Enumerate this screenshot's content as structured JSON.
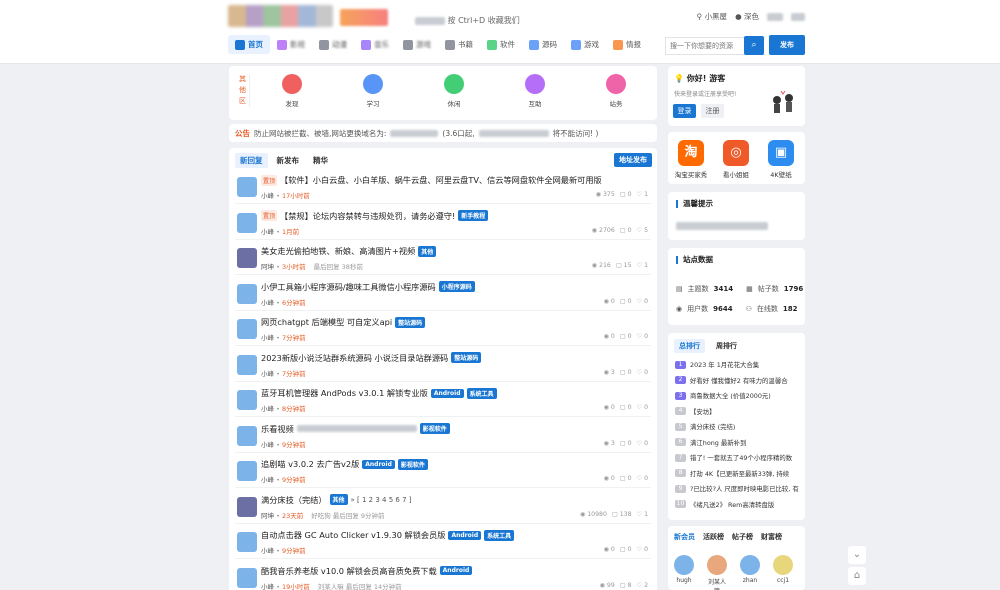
{
  "header": {
    "notice": "按 Ctrl+D 收藏我们",
    "login_label": "小黑屋",
    "register_label": "深色"
  },
  "nav": [
    {
      "label": "首页",
      "icon": "home-icon",
      "color": "#1976d2"
    },
    {
      "label": "影视",
      "icon": "video-icon",
      "color": "#a855f7"
    },
    {
      "label": "动漫",
      "icon": "anime-icon",
      "color": "#6b7280"
    },
    {
      "label": "音乐",
      "icon": "music-icon",
      "color": "#8b5cf6"
    },
    {
      "label": "游戏",
      "icon": "game-icon",
      "color": "#6b7280"
    },
    {
      "label": "书籍",
      "icon": "book-icon",
      "color": "#6b7280"
    },
    {
      "label": "软件",
      "icon": "grid-icon",
      "color": "#22c55e"
    },
    {
      "label": "源码",
      "icon": "code-icon",
      "color": "#3b82f6"
    },
    {
      "label": "游戏",
      "icon": "gamepad-icon",
      "color": "#3b82f6"
    },
    {
      "label": "情报",
      "icon": "info-icon",
      "color": "#f97316"
    }
  ],
  "search": {
    "placeholder": "搜一下你想要的资源",
    "submit_icon": "search-icon",
    "post_label": "发布"
  },
  "quick": {
    "label": "其他区",
    "items": [
      {
        "label": "发现",
        "color": "#ef4444"
      },
      {
        "label": "学习",
        "color": "#3b82f6"
      },
      {
        "label": "休闲",
        "color": "#22c55e"
      },
      {
        "label": "互助",
        "color": "#a855f7"
      },
      {
        "label": "站务",
        "color": "#ec4899"
      }
    ]
  },
  "announcement": {
    "tag": "公告",
    "text": "防止网站被拦截、被墙,网站更换域名为:",
    "text2": "(3.6口起,",
    "text3": "将不能访问! )"
  },
  "feed": {
    "tabs": [
      "新回复",
      "新发布",
      "精华"
    ],
    "address_label": "地址发布",
    "posts": [
      {
        "tag": "置顶",
        "title": "【软件】小白云盘、小白羊版、蜗牛云盘、阿里云盘TV、信云等网盘软件全网最新可用版",
        "badges": [],
        "user": "小峰",
        "time": "17小时前",
        "views": "375",
        "replies": "0",
        "likes": "1",
        "avatar": "#7cb3e8"
      },
      {
        "tag": "置顶",
        "title": "【禁规】论坛内容禁转与违规处罚，请务必遵守!",
        "badges": [
          "新手教程"
        ],
        "user": "小峰",
        "time": "1月前",
        "views": "2706",
        "replies": "0",
        "likes": "5",
        "avatar": "#7cb3e8"
      },
      {
        "tag": "",
        "title": "美女走光偷拍地铁、新娘、高清图片+视频",
        "badges": [
          "其他"
        ],
        "user": "阿坤",
        "time": "3小时前",
        "replier": "最后回复 38秒前",
        "views": "216",
        "replies": "15",
        "likes": "1",
        "avatar": "#6b6fa3"
      },
      {
        "tag": "",
        "title": "小伊工具箱小程序源码/趣味工具微信小程序源码",
        "badges": [
          "小程序源码"
        ],
        "user": "小峰",
        "time": "6分钟前",
        "views": "0",
        "replies": "0",
        "likes": "0",
        "avatar": "#7cb3e8"
      },
      {
        "tag": "",
        "title": "网页chatgpt 后端模型 可自定义api",
        "badges": [
          "整站源码"
        ],
        "user": "小峰",
        "time": "7分钟前",
        "views": "0",
        "replies": "0",
        "likes": "0",
        "avatar": "#7cb3e8"
      },
      {
        "tag": "",
        "title": "2023新版小说泛站群系统源码 小说泛目录站群源码",
        "badges": [
          "整站源码"
        ],
        "user": "小峰",
        "time": "7分钟前",
        "views": "3",
        "replies": "0",
        "likes": "0",
        "avatar": "#7cb3e8"
      },
      {
        "tag": "",
        "title": "蓝牙耳机管理器 AndPods v3.0.1 解锁专业版",
        "badges": [
          "Android",
          "系统工具"
        ],
        "user": "小峰",
        "time": "8分钟前",
        "views": "0",
        "replies": "0",
        "likes": "0",
        "avatar": "#7cb3e8"
      },
      {
        "tag": "",
        "title": "乐看视频",
        "badges": [
          "影视软件"
        ],
        "user": "小峰",
        "time": "9分钟前",
        "views": "3",
        "replies": "0",
        "likes": "0",
        "avatar": "#7cb3e8"
      },
      {
        "tag": "",
        "title": "追剧喵 v3.0.2 去广告v2版",
        "badges": [
          "Android",
          "影视软件"
        ],
        "user": "小峰",
        "time": "9分钟前",
        "views": "0",
        "replies": "0",
        "likes": "0",
        "avatar": "#7cb3e8"
      },
      {
        "tag": "",
        "title": "满分床技（完结）",
        "badges": [
          "其他"
        ],
        "pages": "» [ 1 2 3 4 5 6 7 ]",
        "user": "阿坤",
        "time": "23天前",
        "replier": "好吃狗 最后回复 9分钟前",
        "views": "10980",
        "replies": "138",
        "likes": "1",
        "avatar": "#6b6fa3"
      },
      {
        "tag": "",
        "title": "自动点击器 GC Auto Clicker v1.9.30 解锁会员版",
        "badges": [
          "Android",
          "系统工具"
        ],
        "user": "小峰",
        "time": "9分钟前",
        "views": "0",
        "replies": "0",
        "likes": "0",
        "avatar": "#7cb3e8"
      },
      {
        "tag": "",
        "title": "酷我音乐养老版 v10.0 解锁会员高音质免费下载",
        "badges": [
          "Android"
        ],
        "user": "小峰",
        "time": "19小时前",
        "replier": "刘某人嘛 最后回复 14分钟前",
        "views": "99",
        "replies": "8",
        "likes": "2",
        "avatar": "#7cb3e8"
      }
    ]
  },
  "sidebar": {
    "welcome_title": "你好! 游客",
    "welcome_sub": "快来登录或注册享受吧!",
    "login_label": "登录",
    "register_label": "注册",
    "apps": [
      {
        "label": "淘宝买家秀",
        "glyph": "淘",
        "color": "#ff6a00"
      },
      {
        "label": "看小姐姐",
        "glyph": "◎",
        "color": "#f05a28"
      },
      {
        "label": "4K壁纸",
        "glyph": "▣",
        "color": "#2d8cf0"
      }
    ],
    "warn_title": "温馨提示",
    "stats_title": "站点数据",
    "stats": {
      "topics_label": "主题数",
      "topics": "3414",
      "posts_label": "帖子数",
      "posts": "1796",
      "users_label": "用户数",
      "users": "9644",
      "online_label": "在线数",
      "online": "182"
    },
    "rank_tabs": [
      "总排行",
      "周排行"
    ],
    "rank": [
      {
        "n": "1",
        "text": "2023 年 1月花花大合集",
        "color": "#7c6ff0"
      },
      {
        "n": "2",
        "text": "好看好 懂我懂好2 有味力的温馨合",
        "color": "#7c6ff0"
      },
      {
        "n": "3",
        "text": "商鲁数据大全 (价值2000元)",
        "color": "#7c6ff0"
      },
      {
        "n": "4",
        "text": "【安坊】",
        "color": "#c7c9ce"
      },
      {
        "n": "5",
        "text": "满分床技 (完结)",
        "color": "#c7c9ce"
      },
      {
        "n": "6",
        "text": "满江hong 最新补到",
        "color": "#c7c9ce"
      },
      {
        "n": "7",
        "text": "错了! 一套就五了49个小程序精的数",
        "color": "#c7c9ce"
      },
      {
        "n": "8",
        "text": "打劫 4K【已更新至最新33弹, 持续",
        "color": "#c7c9ce"
      },
      {
        "n": "9",
        "text": "?已比较?人 尺度即时映电影已比较, 有",
        "color": "#c7c9ce"
      },
      {
        "n": "10",
        "text": "《绪凡送2》 Rem高清转盘版",
        "color": "#c7c9ce"
      }
    ],
    "member_tabs": [
      "新会员",
      "活跃榜",
      "帖子榜",
      "财富榜"
    ],
    "members": [
      {
        "name": "hugh",
        "color": "#7cb3e8"
      },
      {
        "name": "刘某人嘛",
        "color": "#e8a77c"
      },
      {
        "name": "zhan",
        "color": "#7cb3e8"
      },
      {
        "name": "ccj1",
        "color": "#e8d67c"
      }
    ]
  }
}
